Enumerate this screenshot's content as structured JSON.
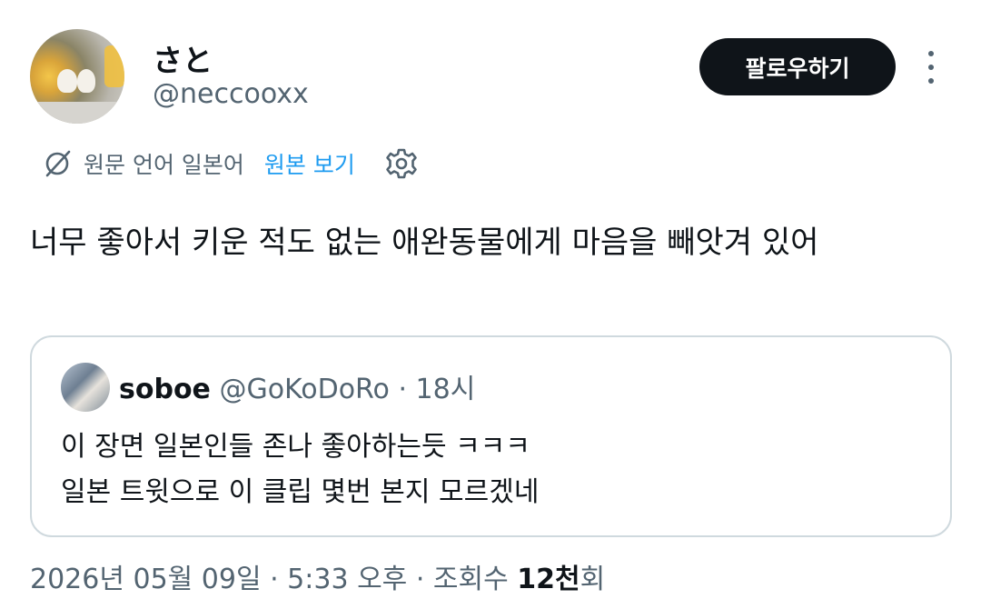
{
  "author": {
    "display_name": "さと",
    "handle": "@neccooxx"
  },
  "follow_button": {
    "label": "팔로우하기"
  },
  "translation": {
    "notice": "원문 언어 일본어",
    "view_original": "원본 보기"
  },
  "tweet": {
    "text": "너무 좋아서 키운 적도 없는 애완동물에게 마음을 빼앗겨 있어"
  },
  "quote": {
    "display_name": "soboe",
    "handle": "@GoKoDoRo",
    "separator": " · ",
    "time": "18시",
    "line1": "이 장면 일본인들 존나 좋아하는듯 ㅋㅋㅋ",
    "line2": "일본 트윗으로 이 클립 몇번 본지 모르겠네"
  },
  "meta": {
    "date": "2026년 05월 09일 · 5:33 오후 · 조회수 ",
    "views": "12천",
    "views_suffix": "회"
  },
  "colors": {
    "primary_text": "#0f1419",
    "secondary_text": "#536471",
    "link": "#1d9bf0",
    "border": "#cfd9de",
    "button_bg": "#0f1419"
  },
  "icons": [
    "translate-icon",
    "gear-icon",
    "more-icon"
  ]
}
